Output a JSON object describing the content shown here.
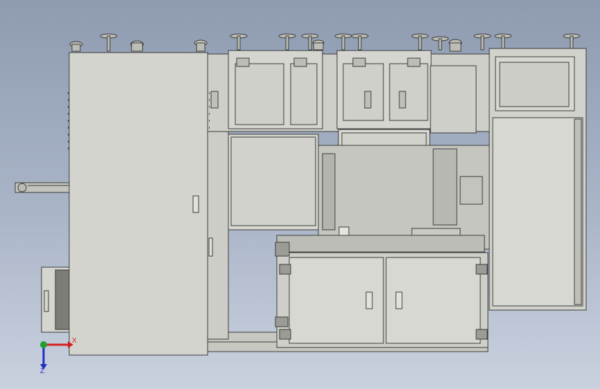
{
  "viewport": {
    "description_free": true,
    "colors": {
      "background_top": "#8e9bb0",
      "background_bottom": "#c9d1de",
      "machine_body": "#d2d2cc",
      "machine_edge": "#3a3a3a",
      "axis_x": "#d42020",
      "axis_y": "#20a030",
      "axis_z": "#2030c0"
    }
  },
  "triad": {
    "x_label": "X",
    "z_label": "Z",
    "x_icon": "arrow-right-icon",
    "z_icon": "arrow-down-icon",
    "origin_icon": "origin-sphere-icon"
  }
}
